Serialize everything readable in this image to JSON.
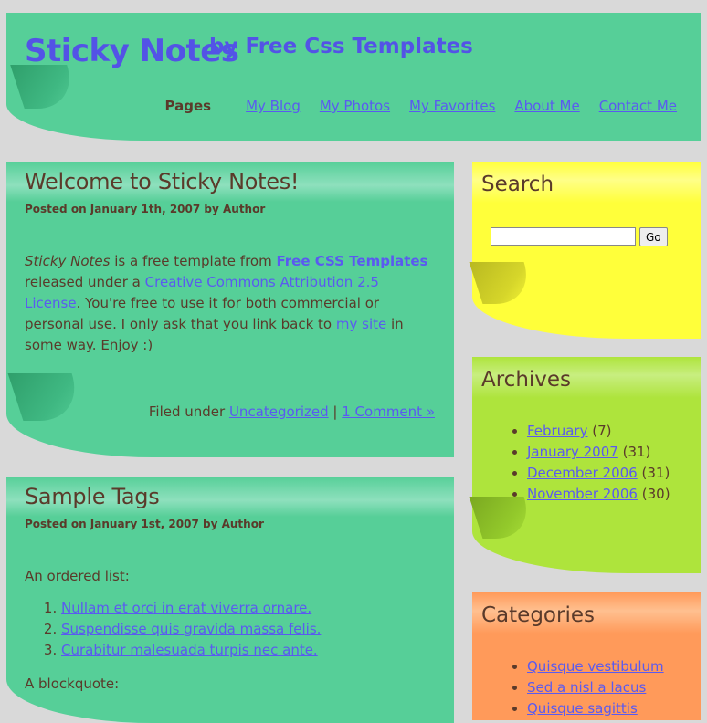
{
  "header": {
    "logo": "Sticky Notes",
    "tagline": "by Free Css Templates",
    "pages_label": "Pages",
    "menu": [
      "My Blog",
      "My Photos",
      "My Favorites",
      "About Me",
      "Contact Me"
    ]
  },
  "posts": [
    {
      "title": "Welcome to Sticky Notes!",
      "meta": "Posted on January 1th, 2007 by Author",
      "body": {
        "em": "Sticky Notes",
        "t1": " is a free template from ",
        "link1": "Free CSS Templates",
        "t2": " released under a ",
        "link2": "Creative Commons Attribution 2.5 License",
        "t3": ". You're free to use it for both commercial or personal use. I only ask that you link back to ",
        "link3": "my site",
        "t4": " in some way. Enjoy :)"
      },
      "footer": {
        "filed": "Filed under ",
        "category": "Uncategorized",
        "sep": " | ",
        "comments": "1 Comment »"
      }
    },
    {
      "title": "Sample Tags",
      "meta": "Posted on January 1st, 2007 by Author",
      "ordered_intro": "An ordered list:",
      "ordered_items": [
        "Nullam et orci in erat viverra ornare.",
        "Suspendisse quis gravida massa felis.",
        "Curabitur malesuada turpis nec ante."
      ],
      "blockquote_intro": "A blockquote:"
    }
  ],
  "sidebar": {
    "search": {
      "title": "Search",
      "input_value": "",
      "button": "Go"
    },
    "archives": {
      "title": "Archives",
      "items": [
        {
          "label": "February",
          "count": "(7)"
        },
        {
          "label": "January 2007",
          "count": "(31)"
        },
        {
          "label": "December 2006",
          "count": "(31)"
        },
        {
          "label": "November 2006",
          "count": "(30)"
        }
      ]
    },
    "categories": {
      "title": "Categories",
      "items": [
        "Quisque vestibulum",
        "Sed a nisl a lacus",
        "Quisque sagittis"
      ]
    }
  },
  "colors": {
    "page_bg": "#d9d9d9",
    "green_note": "#56cf98",
    "yellow_note": "#ffff3a",
    "lime_note": "#aee43c",
    "orange_note": "#ff9a5a",
    "link": "#5a5af0",
    "text": "#5a3a2a"
  }
}
